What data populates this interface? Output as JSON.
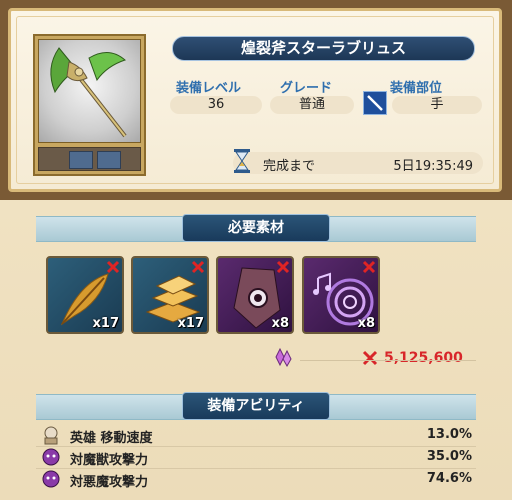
{
  "item": {
    "name": "煌裂斧スターラブリュス",
    "equip_level_label": "装備レベル",
    "equip_level_value": "36",
    "grade_label": "グレード",
    "grade_value": "普通",
    "slot_label": "装備部位",
    "slot_value": "手",
    "complete_label": "完成まで",
    "complete_time": "5日19:35:49"
  },
  "materials": {
    "title": "必要素材",
    "items": [
      {
        "icon": "feather-icon",
        "count": "x17"
      },
      {
        "icon": "gold-bars-icon",
        "count": "x17"
      },
      {
        "icon": "dark-crystal-icon",
        "count": "x8"
      },
      {
        "icon": "music-vortex-icon",
        "count": "x8"
      }
    ],
    "cost": "5,125,600"
  },
  "abilities": {
    "title": "装備アビリティ",
    "rows": [
      {
        "icon": "hero-icon",
        "name": "英雄 移動速度",
        "value": "13.0%"
      },
      {
        "icon": "demon-icon",
        "name": "対魔獣攻撃力",
        "value": "35.0%"
      },
      {
        "icon": "demon-icon",
        "name": "対悪魔攻撃力",
        "value": "74.6%"
      }
    ]
  },
  "colors": {
    "banner_blue": "#1d3756",
    "label_blue": "#2f6fae",
    "cost_red": "#d8262a"
  }
}
